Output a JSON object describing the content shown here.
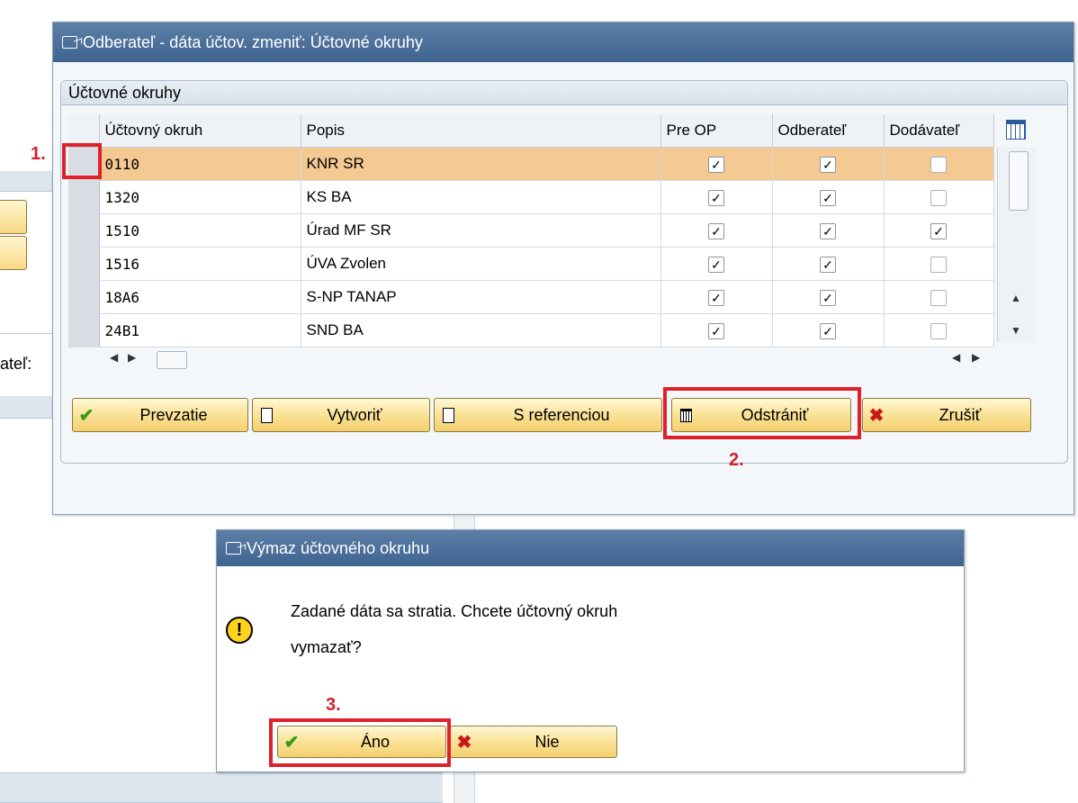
{
  "background": {
    "partial_label": "ateľ:"
  },
  "main_window": {
    "title": "Odberateľ - dáta účtov. zmeniť: Účtovné okruhy",
    "group_title": "Účtovné okruhy",
    "columns": [
      "Účtovný okruh",
      "Popis",
      "Pre OP",
      "Odberateľ",
      "Dodávateľ"
    ],
    "rows": [
      {
        "code": "0110",
        "desc": "KNR SR",
        "pre_op": true,
        "odberatel": true,
        "dodavatel": false,
        "highlighted": true
      },
      {
        "code": "1320",
        "desc": "KS BA",
        "pre_op": true,
        "odberatel": true,
        "dodavatel": false,
        "highlighted": false
      },
      {
        "code": "1510",
        "desc": "Úrad MF SR",
        "pre_op": true,
        "odberatel": true,
        "dodavatel": true,
        "highlighted": false
      },
      {
        "code": "1516",
        "desc": "ÚVA Zvolen",
        "pre_op": true,
        "odberatel": true,
        "dodavatel": false,
        "highlighted": false
      },
      {
        "code": "18A6",
        "desc": "S-NP TANAP",
        "pre_op": true,
        "odberatel": true,
        "dodavatel": false,
        "highlighted": false
      },
      {
        "code": "24B1",
        "desc": "SND BA",
        "pre_op": true,
        "odberatel": true,
        "dodavatel": false,
        "highlighted": false
      }
    ],
    "buttons": {
      "prevzatie": "Prevzatie",
      "vytvorit": "Vytvoriť",
      "s_referenciou": "S referenciou",
      "odstranit": "Odstrániť",
      "zrusit": "Zrušiť"
    }
  },
  "annotations": {
    "step1": "1.",
    "step2": "2.",
    "step3": "3."
  },
  "popup": {
    "title": "Výmaz účtovného okruhu",
    "message_line1": "Zadané dáta sa stratia. Chcete účtovný okruh",
    "message_line2": "vymazať?",
    "yes_label": "Áno",
    "no_label": "Nie"
  },
  "colors": {
    "highlight_row": "#f4c992",
    "annotation_red": "#e0202a",
    "title_bar": "#4a6e98",
    "button_yellow": "#fbe49b"
  }
}
